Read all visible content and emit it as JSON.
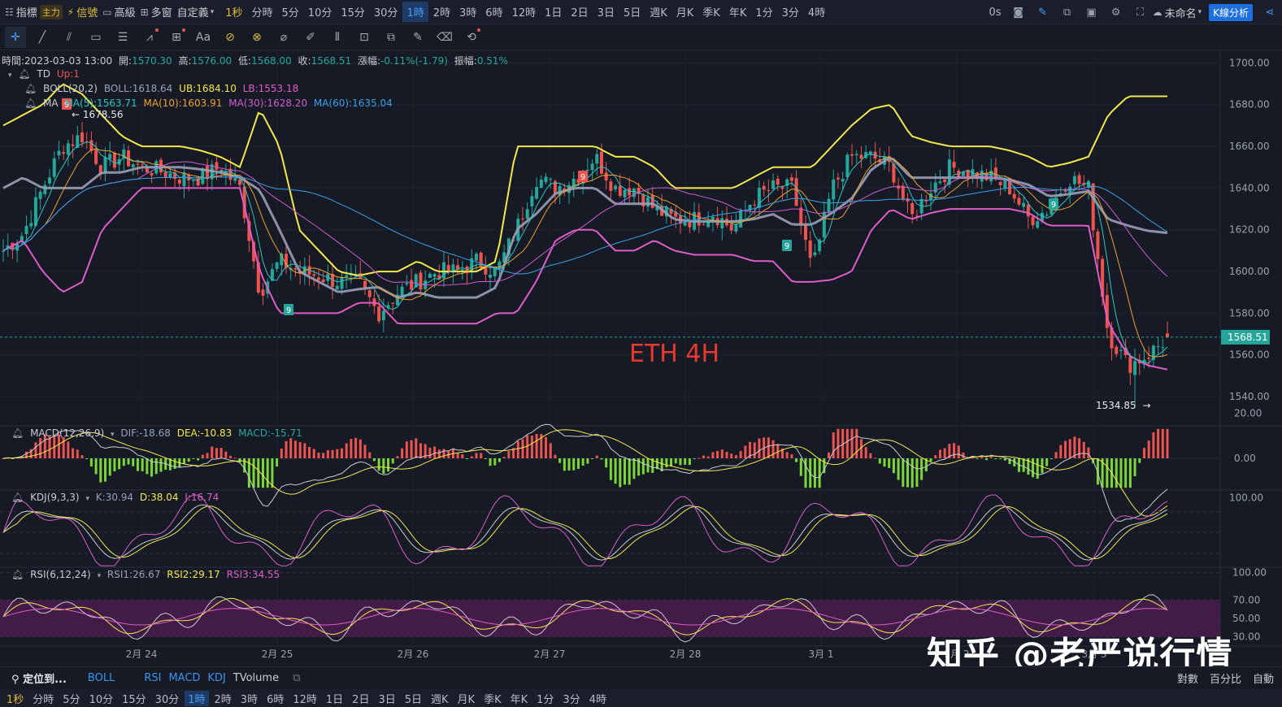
{
  "topbar": {
    "indicators_label": "指標",
    "main_badge": "主力",
    "signal_label": "信號",
    "advanced_label": "高級",
    "multi_window_label": "多窗",
    "custom_label": "自定義",
    "intervals": [
      "1秒",
      "分時",
      "5分",
      "10分",
      "15分",
      "30分",
      "1時",
      "2時",
      "3時",
      "6時",
      "12時",
      "1日",
      "2日",
      "3日",
      "5日",
      "週K",
      "月K",
      "季K",
      "年K",
      "1分",
      "3分",
      "4時"
    ],
    "active_interval": "1時",
    "countdown": "0s",
    "workspace_name": "未命名",
    "kline_analysis_button": "K線分析"
  },
  "toolbar": {
    "tools": [
      "crosshair-icon",
      "trend-line-icon",
      "parallel-channel-icon",
      "rectangle-icon",
      "fib-lines-icon",
      "wave-pattern-icon",
      "measure-icon",
      "text-icon",
      "brush-icon",
      "eraser-icon",
      "ruler-icon",
      "pencil-icon",
      "bars-pattern-icon",
      "lock-icon",
      "copy-icon",
      "edit-icon",
      "trash-icon",
      "magnet-icon"
    ],
    "text_tool_label": "Aa"
  },
  "price_info": {
    "time_label": "時間:",
    "time": "2023-03-03 13:00",
    "open_label": "開:",
    "open": "1570.30",
    "high_label": "高:",
    "high": "1576.00",
    "low_label": "低:",
    "low": "1568.00",
    "close_label": "收:",
    "close": "1568.51",
    "change_label": "漲幅:",
    "change": "-0.11%(-1.79)",
    "amplitude_label": "振幅:",
    "amplitude": "0.51%"
  },
  "td": {
    "name": "TD",
    "value": "Up:1"
  },
  "boll": {
    "name": "BOLL(20,2)",
    "mid": "BOLL:1618.64",
    "ub": "UB:1684.10",
    "lb": "LB:1553.18"
  },
  "ma": {
    "name": "MA",
    "ma5": "MA(5):1563.71",
    "ma10": "MA(10):1603.91",
    "ma30": "MA(30):1628.20",
    "ma60": "MA(60):1635.04"
  },
  "annotations": {
    "high_marker": "1678.56",
    "low_marker": "1534.85",
    "chart_note": "ETH 4H",
    "current_price": "1568.51"
  },
  "macd": {
    "name": "MACD(12,26,9)",
    "dif": "DIF:-18.68",
    "dea": "DEA:-10.83",
    "macd": "MACD:-15.71"
  },
  "kdj": {
    "name": "KDJ(9,3,3)",
    "k": "K:30.94",
    "d": "D:38.04",
    "j": "J:16.74"
  },
  "rsi": {
    "name": "RSI(6,12,24)",
    "rsi1": "RSI1:26.67",
    "rsi2": "RSI2:29.17",
    "rsi3": "RSI3:34.55"
  },
  "bottombar": {
    "locate_label": "定位到...",
    "indicators": [
      "BOLL",
      "RSI",
      "MACD",
      "KDJ",
      "TVolume"
    ],
    "log_label": "對數",
    "percent_label": "百分比",
    "auto_label": "自動"
  },
  "watermark": "知乎 @老严说行情",
  "colors": {
    "up": "#26a69a",
    "down": "#ef5350",
    "ma5": "#2ec4c4",
    "ma10": "#f0a030",
    "ma30": "#cf5bd0",
    "ma60": "#3aa0e8",
    "boll_ub": "#f5e84a",
    "boll_lb": "#e05cc8",
    "boll_mid": "#9aa0b8",
    "accent": "#1d6fe0"
  },
  "chart_data": [
    {
      "type": "candlestick",
      "title": "ETH 4H",
      "x_ticks": [
        "2月 24",
        "2月 25",
        "2月 26",
        "2月 27",
        "2月 28",
        "3月 1",
        "3月 2",
        "3月 3"
      ],
      "y_ticks": [
        1540,
        1560,
        1580,
        1600,
        1620,
        1640,
        1660,
        1680,
        1700
      ],
      "ylim": [
        1526,
        1706
      ],
      "current_price": 1568.51,
      "series_key_points": {
        "close": [
          1610,
          1618,
          1640,
          1660,
          1665,
          1650,
          1655,
          1650,
          1648,
          1645,
          1645,
          1650,
          1640,
          1590,
          1605,
          1600,
          1598,
          1595,
          1595,
          1580,
          1590,
          1595,
          1600,
          1600,
          1605,
          1600,
          1620,
          1645,
          1640,
          1645,
          1655,
          1640,
          1640,
          1630,
          1625,
          1625,
          1628,
          1620,
          1635,
          1640,
          1640,
          1600,
          1640,
          1655,
          1655,
          1650,
          1625,
          1640,
          1650,
          1648,
          1645,
          1640,
          1625,
          1630,
          1645,
          1640,
          1570,
          1555,
          1560,
          1568
        ],
        "boll_ub": [
          1670,
          1675,
          1680,
          1690,
          1685,
          1675,
          1665,
          1660,
          1660,
          1660,
          1658,
          1655,
          1650,
          1678,
          1660,
          1620,
          1610,
          1600,
          1598,
          1600,
          1600,
          1605,
          1600,
          1600,
          1600,
          1605,
          1660,
          1660,
          1660,
          1660,
          1660,
          1655,
          1655,
          1650,
          1640,
          1640,
          1640,
          1640,
          1645,
          1650,
          1650,
          1650,
          1660,
          1670,
          1678,
          1680,
          1665,
          1662,
          1660,
          1660,
          1660,
          1658,
          1655,
          1650,
          1652,
          1655,
          1675,
          1684,
          1684,
          1684
        ],
        "boll_lb": [
          1610,
          1615,
          1600,
          1590,
          1595,
          1620,
          1630,
          1640,
          1640,
          1640,
          1640,
          1640,
          1640,
          1600,
          1580,
          1580,
          1580,
          1580,
          1585,
          1585,
          1575,
          1575,
          1575,
          1575,
          1575,
          1580,
          1580,
          1595,
          1615,
          1620,
          1620,
          1610,
          1610,
          1615,
          1610,
          1608,
          1608,
          1608,
          1605,
          1605,
          1595,
          1595,
          1596,
          1600,
          1620,
          1630,
          1625,
          1628,
          1630,
          1630,
          1630,
          1630,
          1628,
          1622,
          1622,
          1622,
          1575,
          1560,
          1555,
          1553
        ]
      }
    },
    {
      "type": "bar",
      "title": "MACD(12,26,9)",
      "y_ticks": [
        0.0,
        20.0
      ],
      "ylim": [
        -14,
        14
      ]
    },
    {
      "type": "line",
      "title": "KDJ(9,3,3)",
      "y_ticks": [
        100.0
      ],
      "ylim": [
        0,
        110
      ]
    },
    {
      "type": "line",
      "title": "RSI(6,12,24)",
      "y_ticks": [
        30.0,
        50.0,
        70.0,
        100.0
      ],
      "ylim": [
        20,
        105
      ]
    }
  ]
}
